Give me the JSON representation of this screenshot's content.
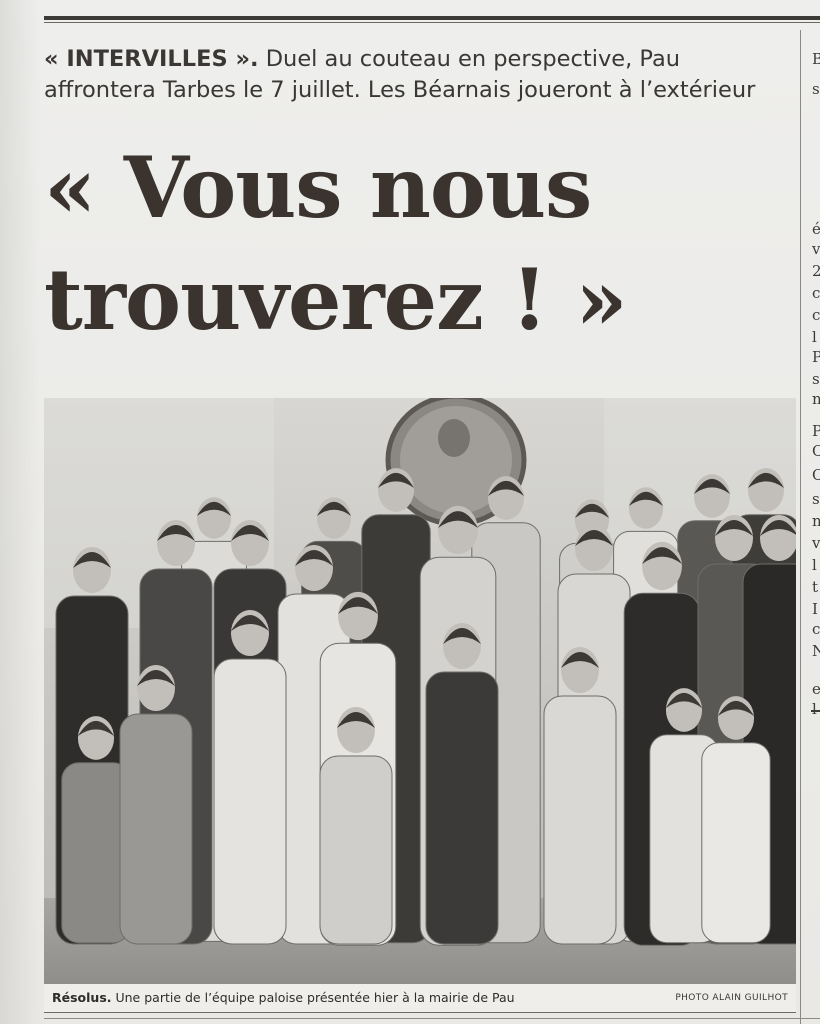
{
  "article": {
    "kicker_bold": "« INTERVILLES ».",
    "kicker_line1": " Duel au couteau en perspective, Pau",
    "kicker_line2": "affrontera Tarbes le 7 juillet. Les Béarnais joueront à l’extérieur",
    "headline_line1": "« Vous nous",
    "headline_line2": "trouverez ! »"
  },
  "photo": {
    "caption_bold": "Résolus.",
    "caption_text": " Une partie de l’équipe paloise présentée hier  à la mairie de Pau",
    "credit": "PHOTO ALAIN GUILHOT"
  },
  "right_column_fragments": [
    "B",
    "s",
    "é",
    "v",
    "2",
    "c",
    "c",
    "l",
    "P",
    "s",
    "n",
    "P",
    "C",
    "C",
    "s",
    "n",
    "v",
    "l",
    "t",
    "I",
    "c",
    "N",
    "e",
    "l"
  ],
  "colors": {
    "paper": "#ecebe8",
    "ink": "#3a332e",
    "photo_gray": "#bdbcb8"
  }
}
